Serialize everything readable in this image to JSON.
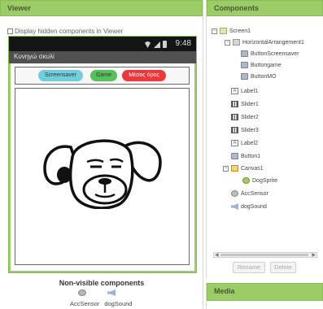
{
  "viewer": {
    "title": "Viewer",
    "hidden_checkbox_label": "Display hidden components in Viewer",
    "phone": {
      "time": "9:48",
      "screen_title": "Κυνηγώ σκυλί",
      "buttons": {
        "screensaver": "Screensaver",
        "game": "Game",
        "mo": "Μέσος όρος"
      }
    },
    "non_visible": {
      "title": "Non-visible components",
      "items": [
        "AccSensor",
        "dogSound"
      ]
    }
  },
  "components": {
    "title": "Components",
    "tree": [
      {
        "label": "Screen1",
        "icon": "screen-icon",
        "toggle": "−"
      },
      {
        "label": "HorizontalArrangement1",
        "icon": "arrangement-icon",
        "toggle": "−"
      },
      {
        "label": "ButtonScreensaver",
        "icon": "button-icon"
      },
      {
        "label": "Buttongame",
        "icon": "button-icon"
      },
      {
        "label": "ButtonMO",
        "icon": "button-icon"
      },
      {
        "label": "Label1",
        "icon": "label-icon"
      },
      {
        "label": "Slider1",
        "icon": "slider-icon"
      },
      {
        "label": "Slider2",
        "icon": "slider-icon"
      },
      {
        "label": "Slider3",
        "icon": "slider-icon"
      },
      {
        "label": "Label2",
        "icon": "label-icon"
      },
      {
        "label": "Button1",
        "icon": "button-icon"
      },
      {
        "label": "Canvas1",
        "icon": "canvas-icon",
        "toggle": "−"
      },
      {
        "label": "DogSprite",
        "icon": "sprite-icon"
      },
      {
        "label": "AccSensor",
        "icon": "accelerometer-icon"
      },
      {
        "label": "dogSound",
        "icon": "sound-icon"
      }
    ],
    "rename_label": "Rename",
    "delete_label": "Delete"
  },
  "media": {
    "title": "Media"
  },
  "colors": {
    "panel_header": "#9ccc65",
    "status_bar": "#141414",
    "title_bar": "#505050",
    "btn_screensaver": "#6fd0dc",
    "btn_game": "#57c05a",
    "btn_mo": "#e8393c"
  }
}
